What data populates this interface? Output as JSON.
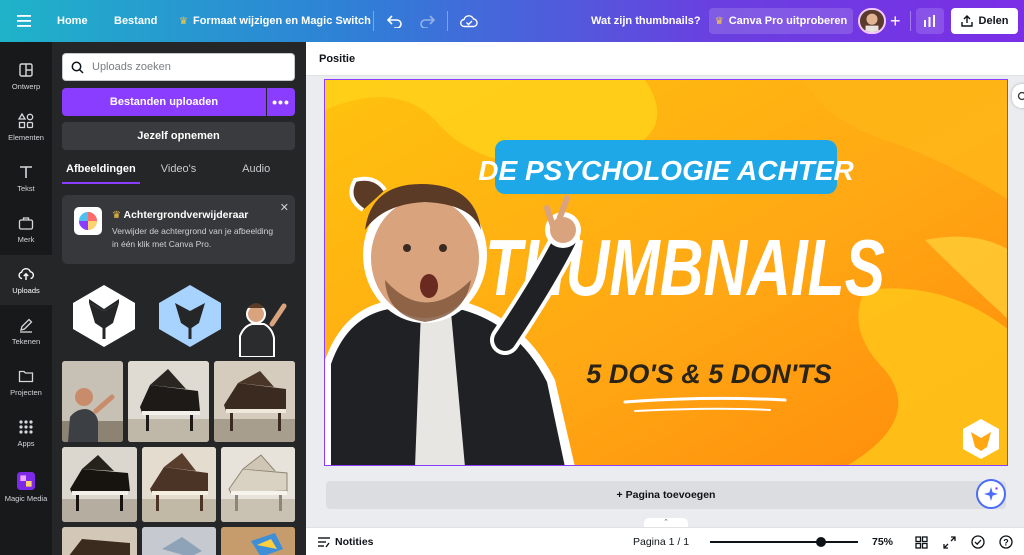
{
  "topbar": {
    "home": "Home",
    "file": "Bestand",
    "resize": "Formaat wijzigen en Magic Switch",
    "design_title": "Wat zijn thumbnails?",
    "pro": "Canva Pro uitproberen",
    "share": "Delen"
  },
  "rail": [
    {
      "label": "Ontwerp",
      "icon": "layout-icon"
    },
    {
      "label": "Elementen",
      "icon": "shapes-icon"
    },
    {
      "label": "Tekst",
      "icon": "text-icon"
    },
    {
      "label": "Merk",
      "icon": "briefcase-icon"
    },
    {
      "label": "Uploads",
      "icon": "cloud-upload-icon"
    },
    {
      "label": "Tekenen",
      "icon": "pen-icon"
    },
    {
      "label": "Projecten",
      "icon": "folder-icon"
    },
    {
      "label": "Apps",
      "icon": "apps-grid-icon"
    },
    {
      "label": "Magic Media",
      "icon": "magic-media-icon"
    }
  ],
  "panel": {
    "search_placeholder": "Uploads zoeken",
    "upload": "Bestanden uploaden",
    "record": "Jezelf opnemen",
    "tabs": [
      "Afbeeldingen",
      "Video's",
      "Audio"
    ],
    "active_tab": 0,
    "promo_title": "Achtergrondverwijderaar",
    "promo_text": "Verwijder de achtergrond van je afbeelding in één klik met Canva Pro."
  },
  "canvas": {
    "toolbar_label": "Positie",
    "add_page": "+ Pagina toevoegen",
    "design": {
      "headline": "DE PSYCHOLOGIE ACHTER",
      "title": "THUMBNAILS",
      "subtitle": "5 DO'S & 5 DON'TS"
    }
  },
  "bottombar": {
    "notes": "Notities",
    "page": "Pagina 1 / 1",
    "zoom_percent": 75,
    "zoom_label": "75%"
  },
  "colors": {
    "accent": "#8b3dff",
    "headline_box": "#1ea8e8",
    "design_orange": "#ff9f0a",
    "design_yellow": "#ffd21a"
  }
}
